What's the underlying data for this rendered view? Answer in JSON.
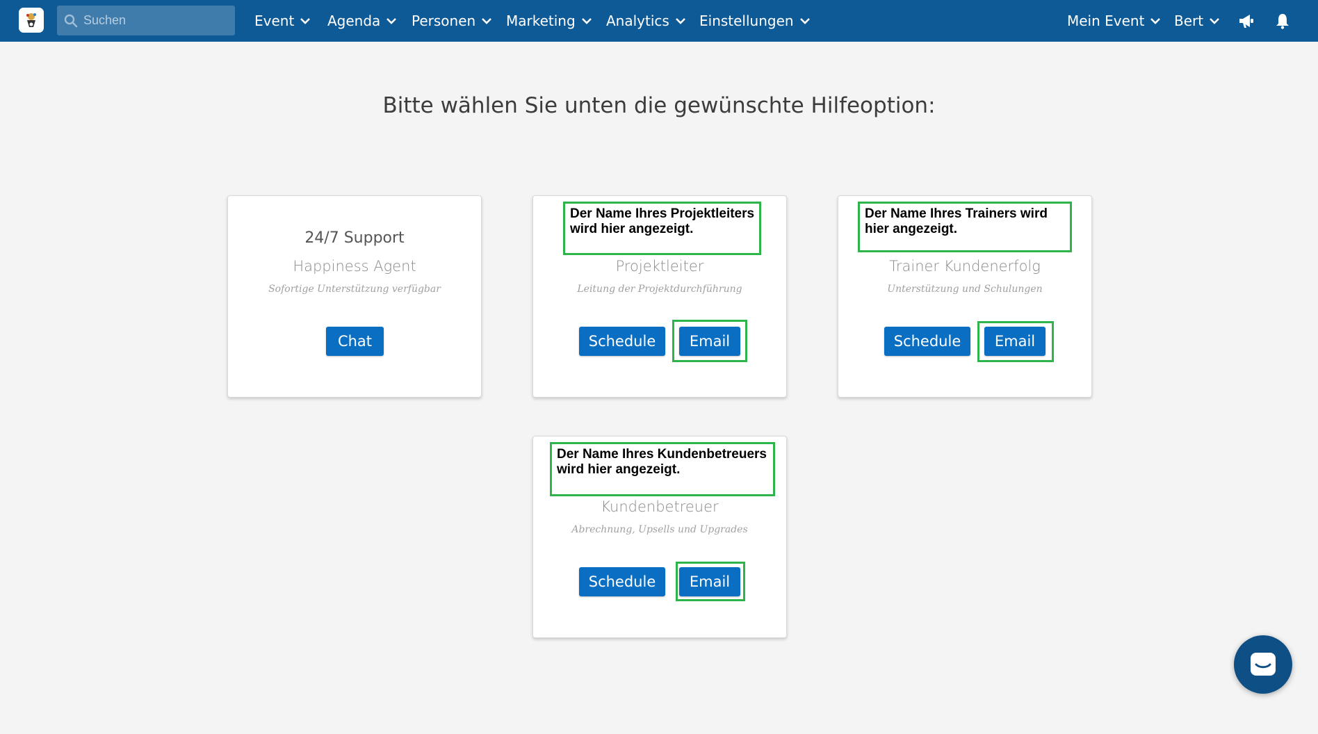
{
  "nav": {
    "search_placeholder": "Suchen",
    "menu": [
      {
        "label": "Event"
      },
      {
        "label": "Agenda"
      },
      {
        "label": "Personen"
      },
      {
        "label": "Marketing"
      },
      {
        "label": "Analytics"
      },
      {
        "label": "Einstellungen"
      }
    ],
    "right_menu": [
      {
        "label": "Mein Event"
      },
      {
        "label": "Bert"
      }
    ],
    "icons": [
      "megaphone-icon",
      "bell-icon"
    ]
  },
  "page": {
    "title": "Bitte wählen Sie unten die gewünschte Hilfeoption:"
  },
  "cards": [
    {
      "heading": "24/7 Support",
      "role": "Happiness Agent",
      "description": "Sofortige Unterstützung verfügbar",
      "buttons": [
        {
          "label": "Chat"
        }
      ]
    },
    {
      "note": "Der Name Ihres Projektleiters wird hier angezeigt.",
      "role": "Projektleiter",
      "description": "Leitung der Projektdurchführung",
      "buttons": [
        {
          "label": "Schedule"
        },
        {
          "label": "Email"
        }
      ]
    },
    {
      "note": "Der Name Ihres Trainers wird hier angezeigt.",
      "role": "Trainer Kundenerfolg",
      "description": "Unterstützung und Schulungen",
      "buttons": [
        {
          "label": "Schedule"
        },
        {
          "label": "Email"
        }
      ]
    },
    {
      "note": "Der Name Ihres Kundenbetreuers wird hier angezeigt.",
      "role": "Kundenbetreuer",
      "description": "Abrechnung, Upsells und Upgrades",
      "buttons": [
        {
          "label": "Schedule"
        },
        {
          "label": "Email"
        }
      ]
    }
  ],
  "colors": {
    "navbar": "#0e5a96",
    "button": "#0a6fc3",
    "highlight": "#2db44a",
    "background": "#f4f4f4"
  }
}
